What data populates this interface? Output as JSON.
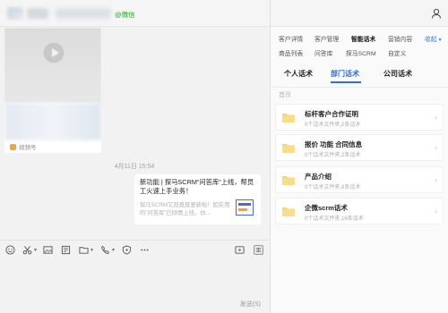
{
  "chat": {
    "wechat_tag": "@微信",
    "video_card": {
      "channel_label": "视频号"
    },
    "timestamp": "4月11日 15:54",
    "link_card": {
      "title": "新功能 | 探马SCRM“问答库”上线，帮员工火速上手业务！",
      "description": "探马SCRM又双叒叕更新啦！如实用的“问答库”已倾情上线，你..."
    }
  },
  "toolbar": {
    "icons": [
      "emoji-icon",
      "scissors-icon",
      "image-icon",
      "file-icon",
      "folder-icon",
      "phone-icon",
      "shield-icon",
      "more-icon",
      "video-icon",
      "panel-icon"
    ]
  },
  "input": {
    "send_label": "发送(S)"
  },
  "right_panel": {
    "nav_row1": [
      "客户详情",
      "客户管理",
      "智能话术",
      "营销内容",
      "收起"
    ],
    "nav_row2": [
      "商品列表",
      "问答库",
      "探马SCRM",
      "自定义"
    ],
    "active_nav": "智能话术",
    "sub_tabs": [
      "个人话术",
      "部门话术",
      "公司话术"
    ],
    "active_sub_tab": "部门话术",
    "breadcrumb": "首页",
    "folders": [
      {
        "title": "标杆客户合作证明",
        "meta": "0个话术文件夹,2条话术"
      },
      {
        "title": "报价 功能 合同信息",
        "meta": "0个话术文件夹,2条话术"
      },
      {
        "title": "产品介绍",
        "meta": "0个话术文件夹,8条话术"
      },
      {
        "title": "企微scrm话术",
        "meta": "0个话术文件夹,16条话术"
      }
    ]
  },
  "colors": {
    "accent": "#2f6fd3",
    "wechat_green": "#1aad19",
    "folder_yellow": "#f7d67a"
  }
}
